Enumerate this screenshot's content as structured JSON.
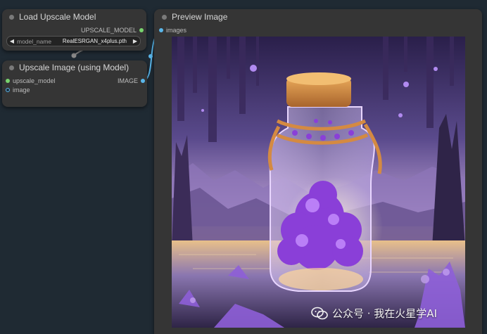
{
  "nodes": {
    "load_upscale_model": {
      "title": "Load Upscale Model",
      "output_label": "UPSCALE_MODEL",
      "widget": {
        "label": "model_name",
        "value": "RealESRGAN_x4plus.pth"
      }
    },
    "upscale_image": {
      "title": "Upscale Image (using Model)",
      "inputs": [
        "upscale_model",
        "image"
      ],
      "output_label": "IMAGE"
    },
    "preview_image": {
      "title": "Preview Image",
      "input_label": "images"
    }
  },
  "watermark": {
    "text": "公众号 · 我在火星学AI"
  },
  "icons": {
    "node_status": "circle-dot-icon",
    "widget_left": "triangle-left-icon",
    "widget_right": "triangle-right-icon",
    "watermark_logo": "wechat-logo-icon"
  },
  "colors": {
    "canvas": "#1f2a33",
    "node_bg": "#353535",
    "model_slot": "#78d36e",
    "image_slot": "#5ab6ea",
    "link": "#5ab6ea"
  }
}
